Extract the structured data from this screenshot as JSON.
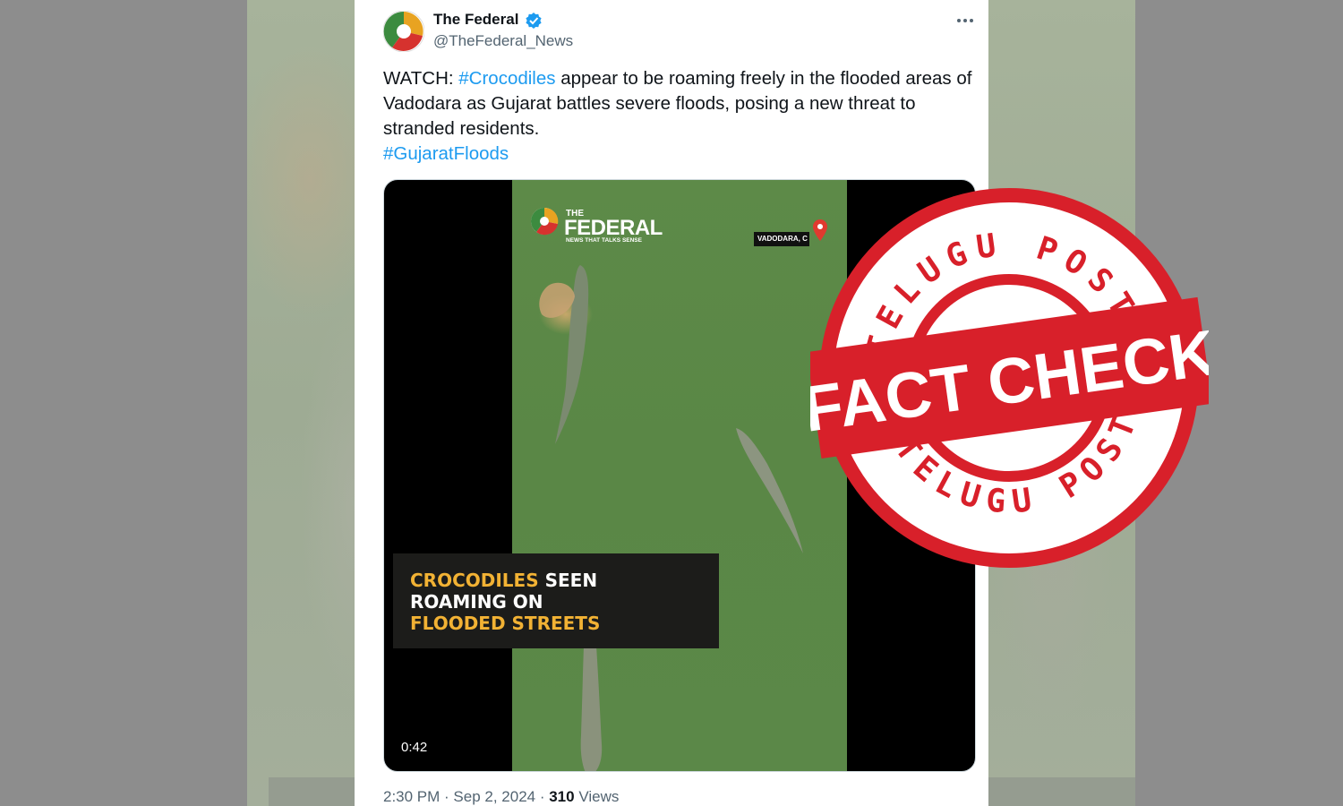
{
  "tweet": {
    "author_name": "The Federal",
    "handle": "@TheFederal_News",
    "text_prefix": "WATCH: ",
    "hashtag_1": "#Crocodiles",
    "text_body": " appear to be roaming freely in the flooded areas of Vadodara as Gujarat battles severe floods, posing a new threat to stranded residents.",
    "hashtag_2": "#GujaratFloods",
    "timestamp": "2:30 PM · Sep 2, 2024 · ",
    "views_count": "310",
    "views_label": " Views"
  },
  "video": {
    "brand_the": "THE",
    "brand_name": "FEDERAL",
    "brand_tagline": "NEWS THAT TALKS SENSE",
    "location_label": "VADODARA, C",
    "caption_line1_highlight": "CROCODILES",
    "caption_line1_rest": " SEEN",
    "caption_line2": "ROAMING ON",
    "caption_line3": "FLOODED STREETS",
    "duration": "0:42"
  },
  "stamp": {
    "top_text": "TELUGU POST",
    "banner_text": "FACT CHECK",
    "bottom_text": "TELUGU POST"
  },
  "colors": {
    "link": "#1d9bf0",
    "stamp_red": "#d8202a",
    "caption_highlight": "#f2b234"
  }
}
